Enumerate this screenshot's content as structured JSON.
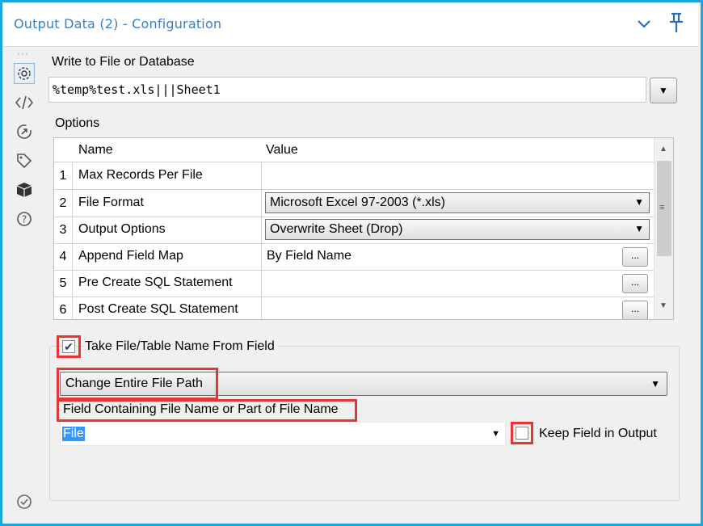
{
  "title": "Output Data (2) - Configuration",
  "header_icons": [
    "chevron-down-icon",
    "pin-icon"
  ],
  "sidebar_tools": [
    "configuration-gear-icon",
    "xml-code-icon",
    "rename-annotation-icon",
    "tag-icon",
    "package-cube-icon",
    "help-question-icon"
  ],
  "write_label": "Write to File or Database",
  "write_value": "%temp%test.xls|||Sheet1",
  "options_label": "Options",
  "grid": {
    "col_name": "Name",
    "col_value": "Value",
    "rows": [
      {
        "num": "1",
        "name": "Max Records Per File",
        "value": ""
      },
      {
        "num": "2",
        "name": "File Format",
        "value": "Microsoft Excel 97-2003 (*.xls)"
      },
      {
        "num": "3",
        "name": "Output Options",
        "value": "Overwrite Sheet (Drop)"
      },
      {
        "num": "4",
        "name": "Append Field Map",
        "value": "By Field Name",
        "button": "..."
      },
      {
        "num": "5",
        "name": "Pre Create SQL Statement",
        "value": "",
        "button": "..."
      },
      {
        "num": "6",
        "name": "Post Create SQL Statement",
        "value": "",
        "button": "..."
      }
    ]
  },
  "take_file": {
    "label": "Take File/Table Name From Field",
    "checked": true
  },
  "change_mode": "Change Entire File Path",
  "field_label": "Field Containing File Name or Part of File Name",
  "field_value": "File",
  "keep_field": {
    "label": "Keep Field in Output",
    "checked": false
  },
  "colors": {
    "accent": "#1aa6e0",
    "title": "#3a7fc1",
    "highlight": "#e53636",
    "selection": "#3399ff"
  }
}
